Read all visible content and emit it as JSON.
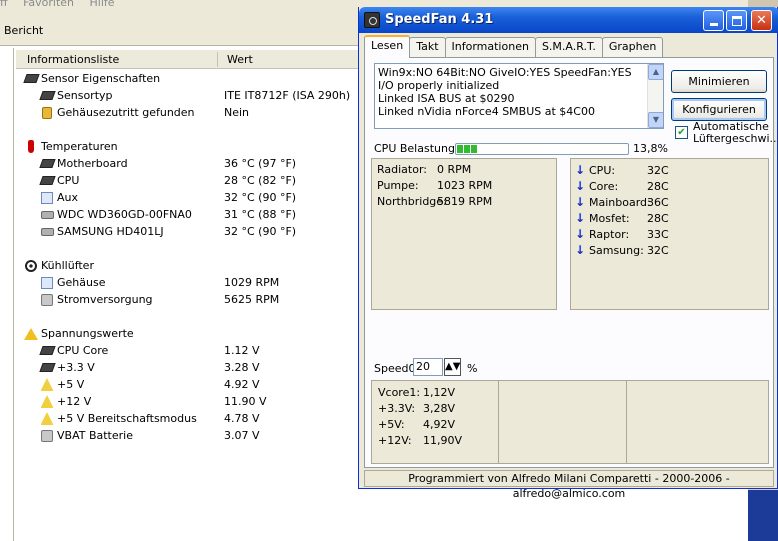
{
  "background_window": {
    "menu": [
      "ff",
      "Favoriten",
      "Hilfe"
    ],
    "toolbar_label": "Bericht",
    "columns": {
      "list": "Informationsliste",
      "value": "Wert"
    },
    "groups": [
      {
        "label": "Sensor Eigenschaften",
        "icon": "sensor-chip-icon",
        "items": [
          {
            "label": "Sensortyp",
            "value": "ITE IT8712F  (ISA 290h)",
            "icon": "chip-icon"
          },
          {
            "label": "Gehäusezutritt gefunden",
            "value": "Nein",
            "icon": "lock-icon"
          }
        ]
      },
      {
        "label": "Temperaturen",
        "icon": "thermometer-icon",
        "items": [
          {
            "label": "Motherboard",
            "value": "36 °C  (97 °F)",
            "icon": "motherboard-icon"
          },
          {
            "label": "CPU",
            "value": "28 °C  (82 °F)",
            "icon": "cpu-icon"
          },
          {
            "label": "Aux",
            "value": "32 °C  (90 °F)",
            "icon": "aux-icon"
          },
          {
            "label": "WDC WD360GD-00FNA0",
            "value": "31 °C  (88 °F)",
            "icon": "hdd-icon"
          },
          {
            "label": "SAMSUNG HD401LJ",
            "value": "32 °C  (90 °F)",
            "icon": "hdd-icon"
          }
        ]
      },
      {
        "label": "Kühllüfter",
        "icon": "fan-icon",
        "items": [
          {
            "label": "Gehäuse",
            "value": "1029 RPM",
            "icon": "case-icon"
          },
          {
            "label": "Stromversorgung",
            "value": "5625 RPM",
            "icon": "psu-icon"
          }
        ]
      },
      {
        "label": "Spannungswerte",
        "icon": "warning-icon",
        "items": [
          {
            "label": "CPU Core",
            "value": "1.12 V",
            "icon": "cpu-icon"
          },
          {
            "label": "+3.3 V",
            "value": "3.28 V",
            "icon": "cpu-icon"
          },
          {
            "label": "+5 V",
            "value": "4.92 V",
            "icon": "voltage-icon"
          },
          {
            "label": "+12 V",
            "value": "11.90 V",
            "icon": "voltage-icon"
          },
          {
            "label": "+5 V Bereitschaftsmodus",
            "value": "4.78 V",
            "icon": "voltage-icon"
          },
          {
            "label": "VBAT Batterie",
            "value": "3.07 V",
            "icon": "battery-icon"
          }
        ]
      }
    ]
  },
  "speedfan": {
    "title": "SpeedFan 4.31",
    "tabs": [
      "Lesen",
      "Takt",
      "Informationen",
      "S.M.A.R.T.",
      "Graphen"
    ],
    "active_tab": "Lesen",
    "log_lines": [
      "Win9x:NO  64Bit:NO  GiveIO:YES  SpeedFan:YES",
      "I/O properly initialized",
      "Linked ISA BUS at $0290",
      "Linked nVidia nForce4 SMBUS at $4C00"
    ],
    "buttons": {
      "minimize": "Minimieren",
      "configure": "Konfigurieren"
    },
    "auto_fan": {
      "label_line1": "Automatische",
      "label_line2": "Lüftergeschwi...",
      "checked": true
    },
    "cpu_usage": {
      "label": "CPU Belastung",
      "percent_text": "13,8%",
      "percent": 13.8
    },
    "fans": [
      {
        "label": "Radiator:",
        "value": "0 RPM"
      },
      {
        "label": "Pumpe:",
        "value": "1023 RPM"
      },
      {
        "label": "Northbridge:",
        "value": "5819 RPM"
      }
    ],
    "temps": [
      {
        "label": "CPU:",
        "value": "32C"
      },
      {
        "label": "Core:",
        "value": "28C"
      },
      {
        "label": "Mainboard:",
        "value": "36C"
      },
      {
        "label": "Mosfet:",
        "value": "28C"
      },
      {
        "label": "Raptor:",
        "value": "33C"
      },
      {
        "label": "Samsung:",
        "value": "32C"
      }
    ],
    "speed": {
      "label": "Speed01:",
      "value": "20",
      "unit": "%"
    },
    "voltages": [
      {
        "label": "Vcore1:",
        "value": "1,12V"
      },
      {
        "label": "+3.3V:",
        "value": "3,28V"
      },
      {
        "label": "+5V:",
        "value": "4,92V"
      },
      {
        "label": "+12V:",
        "value": "11,90V"
      }
    ],
    "status": "Programmiert von Alfredo Milani Comparetti - 2000-2006 - alfredo@almico.com",
    "colors": {
      "title_bar": "#0846c8",
      "progress": "#2fbd2f",
      "temp_arrow": "#1030d0"
    }
  }
}
